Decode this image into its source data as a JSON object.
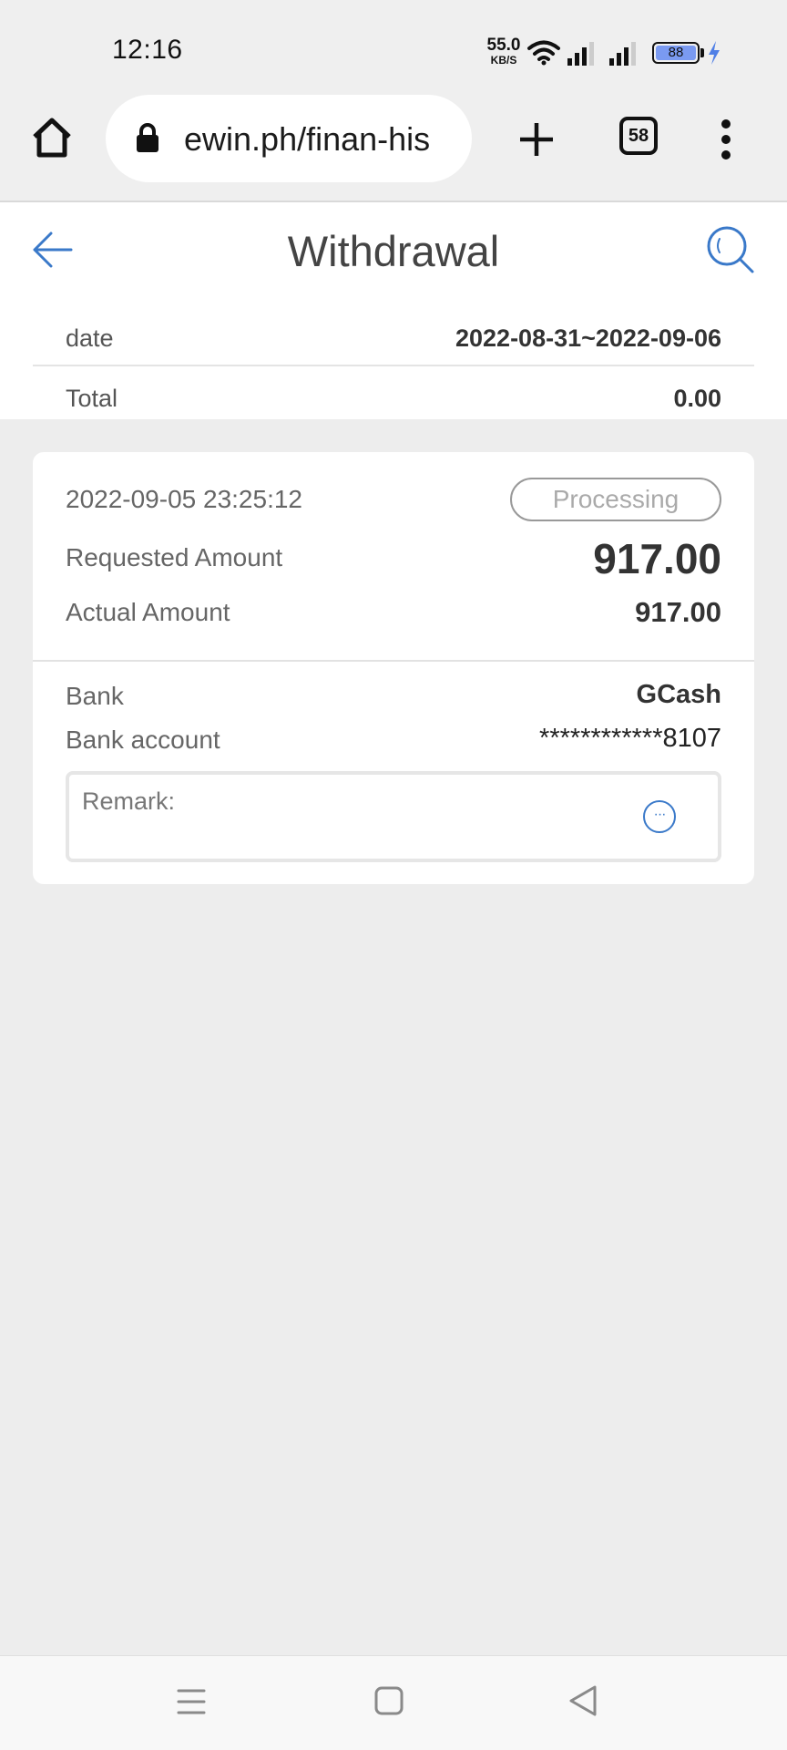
{
  "status_bar": {
    "time": "12:16",
    "net_speed_value": "55.0",
    "net_speed_unit": "KB/S",
    "battery": "88",
    "battery_color": "#7a9af1"
  },
  "browser": {
    "url": "ewin.ph/finan-his",
    "tab_count": "58",
    "icons": [
      "home-icon",
      "lock-icon",
      "plus-icon",
      "more-vertical-icon"
    ]
  },
  "header": {
    "title": "Withdrawal",
    "accent_color": "#3a79c9"
  },
  "filters": {
    "date_label": "date",
    "date_value": "2022-08-31~2022-09-06",
    "total_label": "Total",
    "total_value": "0.00"
  },
  "record": {
    "datetime": "2022-09-05 23:25:12",
    "status": "Processing",
    "requested_label": "Requested Amount",
    "requested_value": "917.00",
    "actual_label": "Actual Amount",
    "actual_value": "917.00",
    "bank_label": "Bank",
    "bank_value": "GCash",
    "account_label": "Bank account",
    "account_value": "************8107",
    "remark_label": "Remark:",
    "more_glyph": "···"
  },
  "nav": {
    "icons": [
      "menu-icon",
      "home-square-icon",
      "back-triangle-icon"
    ]
  }
}
